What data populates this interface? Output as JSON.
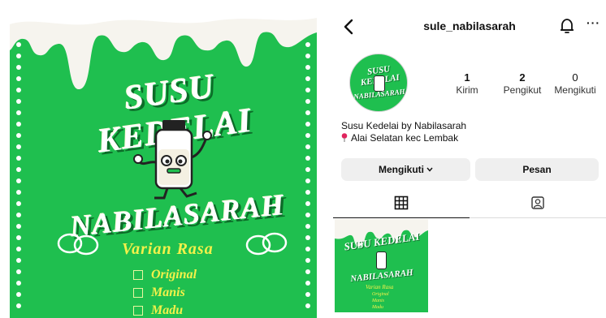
{
  "poster": {
    "title_line1": "SUSU KEDELAI",
    "title_line2": "NABILASARAH",
    "subtitle": "Varian Rasa",
    "flavors": [
      "Original",
      "Manis",
      "Madu"
    ]
  },
  "profile": {
    "username": "sule_nabilasarah",
    "stats": {
      "posts": {
        "count": "1",
        "label": "Kirim"
      },
      "followers": {
        "count": "2",
        "label": "Pengikut"
      },
      "following": {
        "count": "0",
        "label": "Mengikuti"
      }
    },
    "bio": {
      "name_line": "Susu Kedelai by Nabilasarah",
      "location_line": "Alai Selatan kec Lembak"
    },
    "buttons": {
      "following": "Mengikuti",
      "message": "Pesan"
    },
    "more_label": "···"
  },
  "icons": {
    "back": "chevron-left-icon",
    "notifications": "bell-icon",
    "more": "more-horizontal-icon",
    "grid": "grid-icon",
    "tagged": "tagged-person-icon",
    "location": "pin-icon"
  },
  "colors": {
    "poster_green": "#1fbf4f",
    "flavor_yellow": "#f3f14a",
    "button_gray": "#efefef",
    "pin_red": "#e0245e"
  }
}
